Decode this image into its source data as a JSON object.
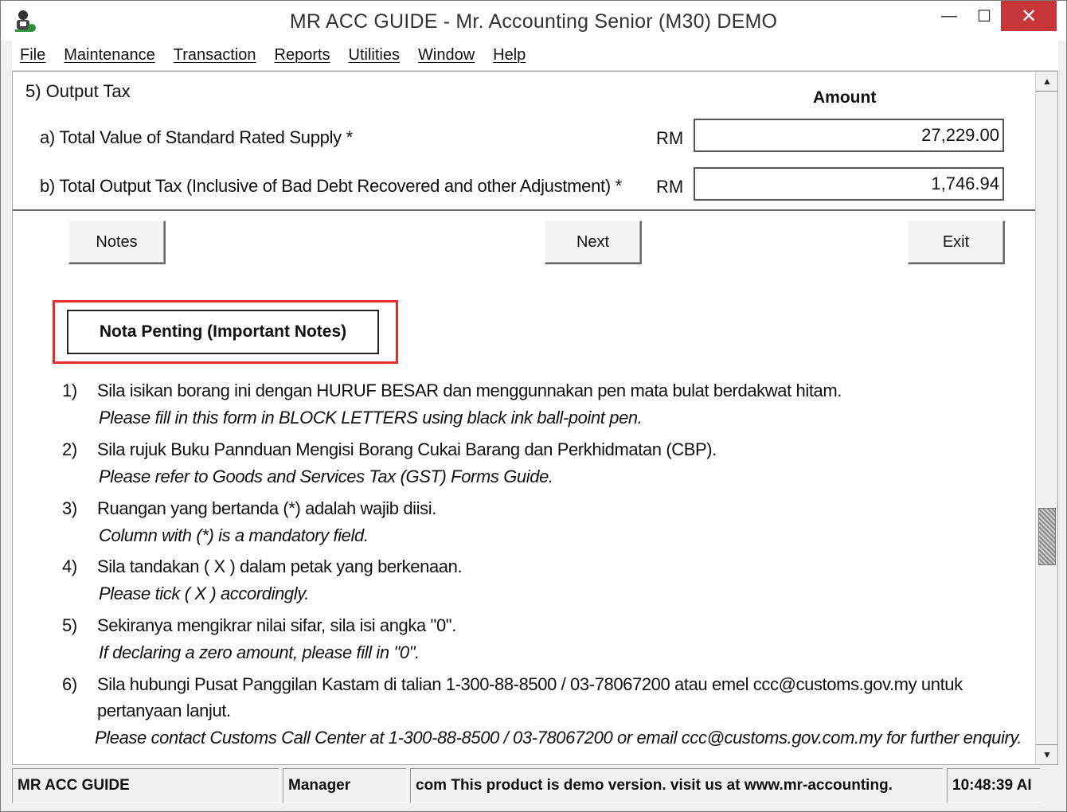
{
  "window": {
    "title": "MR ACC GUIDE - Mr. Accounting Senior (M30) DEMO",
    "minimize_glyph": "—",
    "maximize_glyph": "☐",
    "close_glyph": "✕"
  },
  "menu": [
    "File",
    "Maintenance",
    "Transaction",
    "Reports",
    "Utilities",
    "Window",
    "Help"
  ],
  "form": {
    "section_title": "5)  Output Tax",
    "amount_header": "Amount",
    "rows": [
      {
        "label": "a)   Total Value of Standard Rated Supply *",
        "currency": "RM",
        "value": "27,229.00"
      },
      {
        "label": "b)   Total Output Tax (Inclusive of Bad Debt Recovered and other Adjustment) *",
        "currency": "RM",
        "value": "1,746.94"
      }
    ]
  },
  "buttons": {
    "notes": "Notes",
    "next": "Next",
    "exit": "Exit"
  },
  "important_notes": {
    "title": "Nota Penting (Important Notes)",
    "items": [
      {
        "num": "1)",
        "ms": "Sila isikan borang ini dengan HURUF BESAR dan menggunnakan pen mata bulat berdakwat hitam.",
        "en": "Please fill in this form in BLOCK LETTERS using black ink ball-point pen."
      },
      {
        "num": "2)",
        "ms": "Sila rujuk Buku Pannduan Mengisi Borang Cukai Barang dan Perkhidmatan (CBP).",
        "en": "Please refer to Goods and Services Tax (GST) Forms Guide."
      },
      {
        "num": "3)",
        "ms": "Ruangan yang bertanda (*) adalah wajib diisi.",
        "en": "Column with (*) is a mandatory field."
      },
      {
        "num": "4)",
        "ms": "Sila tandakan ( X ) dalam petak yang berkenaan.",
        "en": "Please tick ( X ) accordingly."
      },
      {
        "num": "5)",
        "ms": "Sekiranya mengikrar nilai sifar, sila isi angka \"0\".",
        "en": "If declaring a zero amount, please fill in \"0\"."
      },
      {
        "num": "6)",
        "ms": "Sila hubungi Pusat Panggilan Kastam di talian 1-300-88-8500 / 03-78067200 atau emel ccc@customs.gov.my untuk",
        "ms_line2": "pertanyaan lanjut.",
        "en": "Please contact Customs Call Center at 1-300-88-8500 / 03-78067200 or email ccc@customs.gov.com.my for further enquiry."
      }
    ]
  },
  "statusbar": {
    "app": "MR ACC GUIDE",
    "user": "Manager",
    "message": "com This product is demo version.  visit us at www.mr-accounting.",
    "time": "10:48:39 AI"
  },
  "scrollbar": {
    "up_glyph": "▲",
    "down_glyph": "▼"
  },
  "colors": {
    "close_button": "#c7373a",
    "highlight_border": "#e0302b"
  }
}
